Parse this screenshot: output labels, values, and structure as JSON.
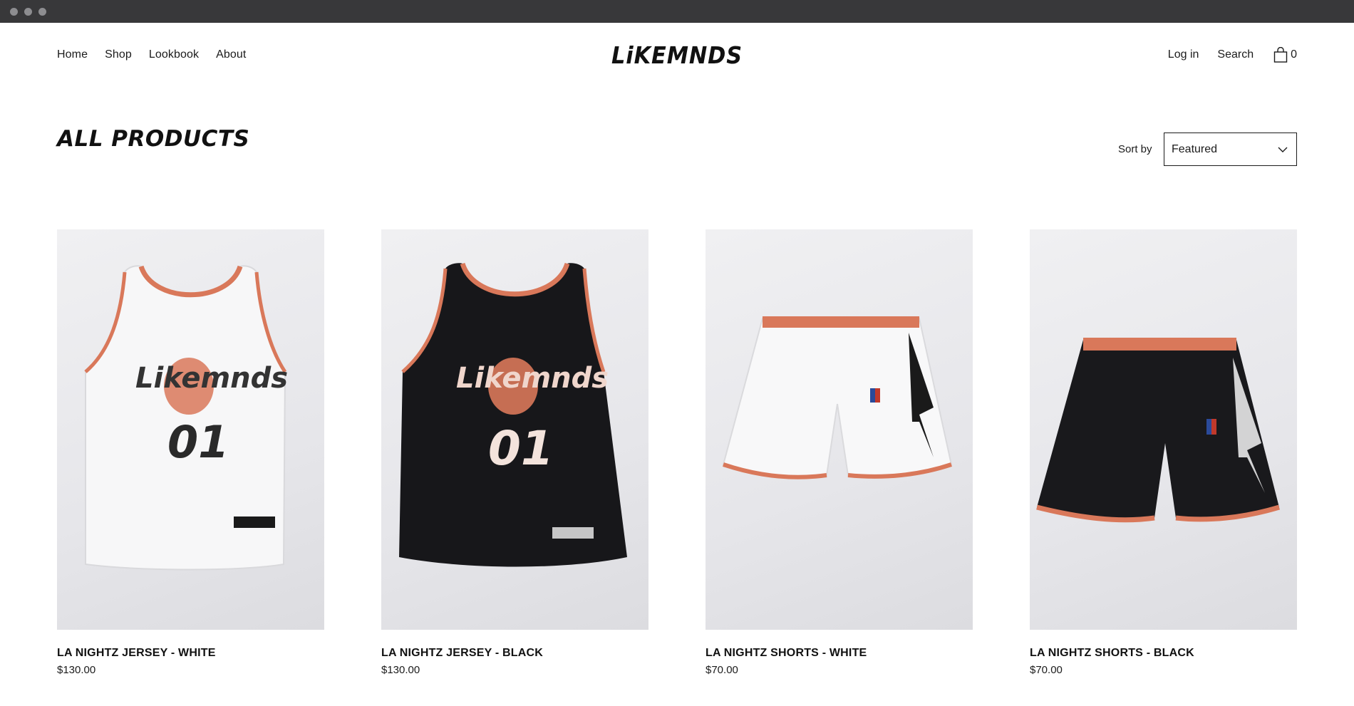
{
  "nav": {
    "left": [
      "Home",
      "Shop",
      "Lookbook",
      "About"
    ],
    "logo": "LiKEMNDS",
    "login": "Log in",
    "search": "Search",
    "cart_count": "0"
  },
  "page": {
    "title": "ALL PRODUCTS"
  },
  "sort": {
    "label": "Sort by",
    "value": "Featured"
  },
  "products": [
    {
      "name": "LA NIGHTZ JERSEY - WHITE",
      "price": "$130.00",
      "garment": "jersey",
      "color": "white"
    },
    {
      "name": "LA NIGHTZ JERSEY - BLACK",
      "price": "$130.00",
      "garment": "jersey",
      "color": "black"
    },
    {
      "name": "LA NIGHTZ SHORTS - WHITE",
      "price": "$70.00",
      "garment": "shorts",
      "color": "white"
    },
    {
      "name": "LA NIGHTZ SHORTS - BLACK",
      "price": "$70.00",
      "garment": "shorts",
      "color": "black"
    }
  ],
  "colors": {
    "accent": "#d9785a",
    "text": "#1b1b1b",
    "titlebar": "#38383a"
  }
}
